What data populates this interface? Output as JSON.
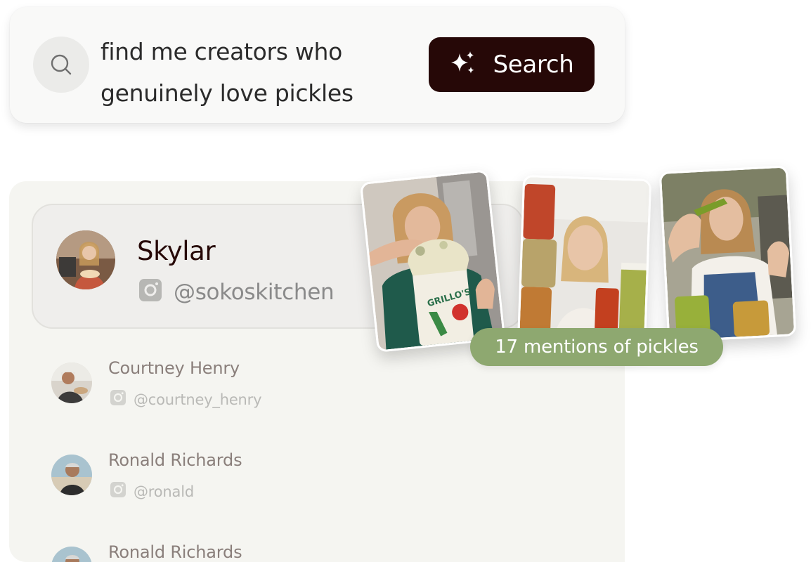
{
  "search": {
    "query_line1": "find me creators who",
    "query_line2": "genuinely love pickles",
    "button_label": "Search"
  },
  "featured_creator": {
    "name": "Skylar",
    "handle": "@sokoskitchen",
    "platform_icon": "instagram-icon"
  },
  "creators": [
    {
      "name": "Courtney Henry",
      "handle": "@courtney_henry",
      "platform_icon": "instagram-icon"
    },
    {
      "name": "Ronald Richards",
      "handle": "@ronald",
      "platform_icon": "instagram-icon"
    },
    {
      "name": "Ronald Richards",
      "handle": "",
      "platform_icon": "instagram-icon"
    }
  ],
  "media": {
    "mentions_label": "17 mentions of pickles",
    "thumbnails": [
      "pickle-dip-video",
      "pickle-jars-video",
      "pickle-eating-video"
    ]
  },
  "colors": {
    "button_bg": "#260807",
    "pill_bg": "#8ea870",
    "panel_bg": "#f5f5f1"
  }
}
